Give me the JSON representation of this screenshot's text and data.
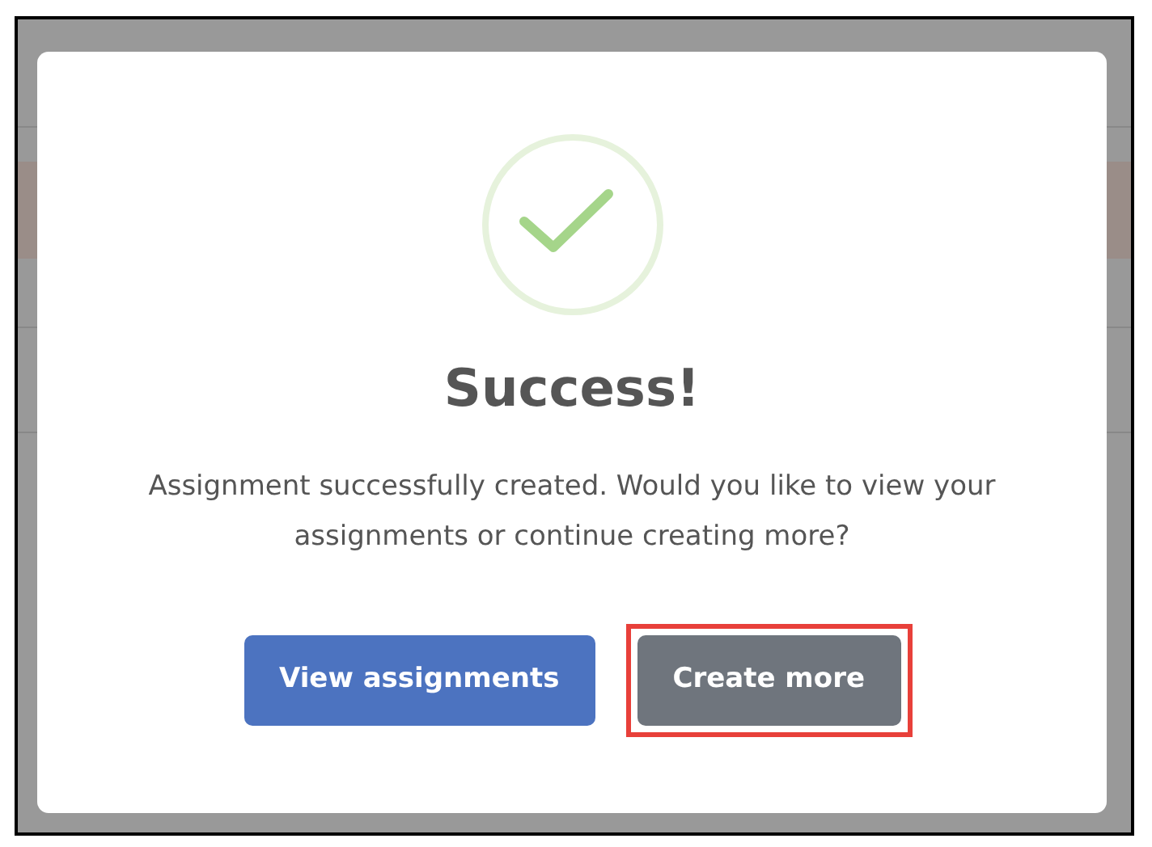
{
  "dialog": {
    "title": "Success!",
    "message": "Assignment successfully created. Would you like to view your assignments or continue creating more?",
    "buttons": [
      {
        "label": "View assignments",
        "kind": "primary",
        "highlighted": false
      },
      {
        "label": "Create more",
        "kind": "secondary",
        "highlighted": true
      }
    ]
  }
}
